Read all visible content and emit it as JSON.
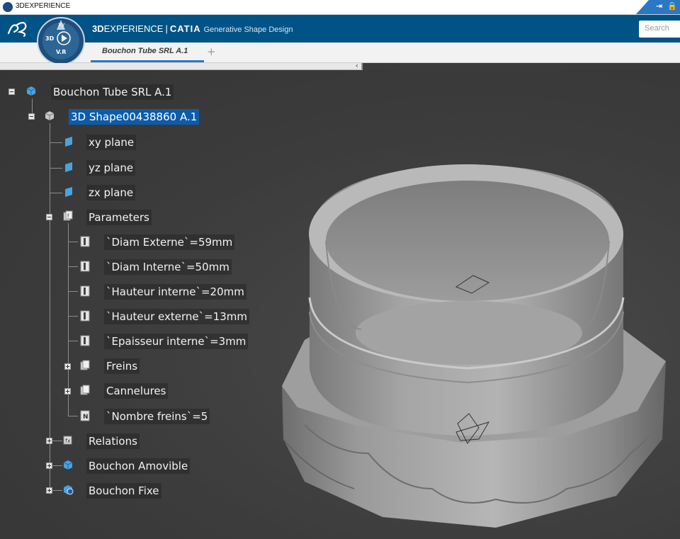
{
  "window": {
    "title": "3DEXPERIENCE"
  },
  "header": {
    "brand_bold": "3D",
    "brand_rest": "EXPERIENCE",
    "separator": "|",
    "product": "CATIA",
    "app_name": "Generative Shape Design",
    "compass_3d": "3D",
    "compass_vr": "V.R",
    "search_placeholder": "Search"
  },
  "tabs": [
    {
      "label": "Bouchon Tube SRL A.1",
      "active": true
    }
  ],
  "add_tab": "+",
  "tree": {
    "root": "Bouchon Tube SRL A.1",
    "shape": "3D Shape00438860 A.1",
    "planes": [
      "xy plane",
      "yz plane",
      "zx plane"
    ],
    "parameters": "Parameters",
    "params": [
      "`Diam Externe`=59mm",
      "`Diam Interne`=50mm",
      "`Hauteur interne`=20mm",
      "`Hauteur externe`=13mm",
      "`Epaisseur interne`=3mm"
    ],
    "freins": "Freins",
    "cannelures": "Cannelures",
    "nombre_freins": "`Nombre freins`=5",
    "relations": "Relations",
    "bouchon_amovible": "Bouchon Amovible",
    "bouchon_fixe": "Bouchon Fixe"
  },
  "colors": {
    "header_bg": "#005386",
    "tab_accent": "#2a78c4",
    "selection": "#0e5ca8",
    "viewport_bg": "#3b3b3b",
    "model": "#a8a8a8"
  }
}
